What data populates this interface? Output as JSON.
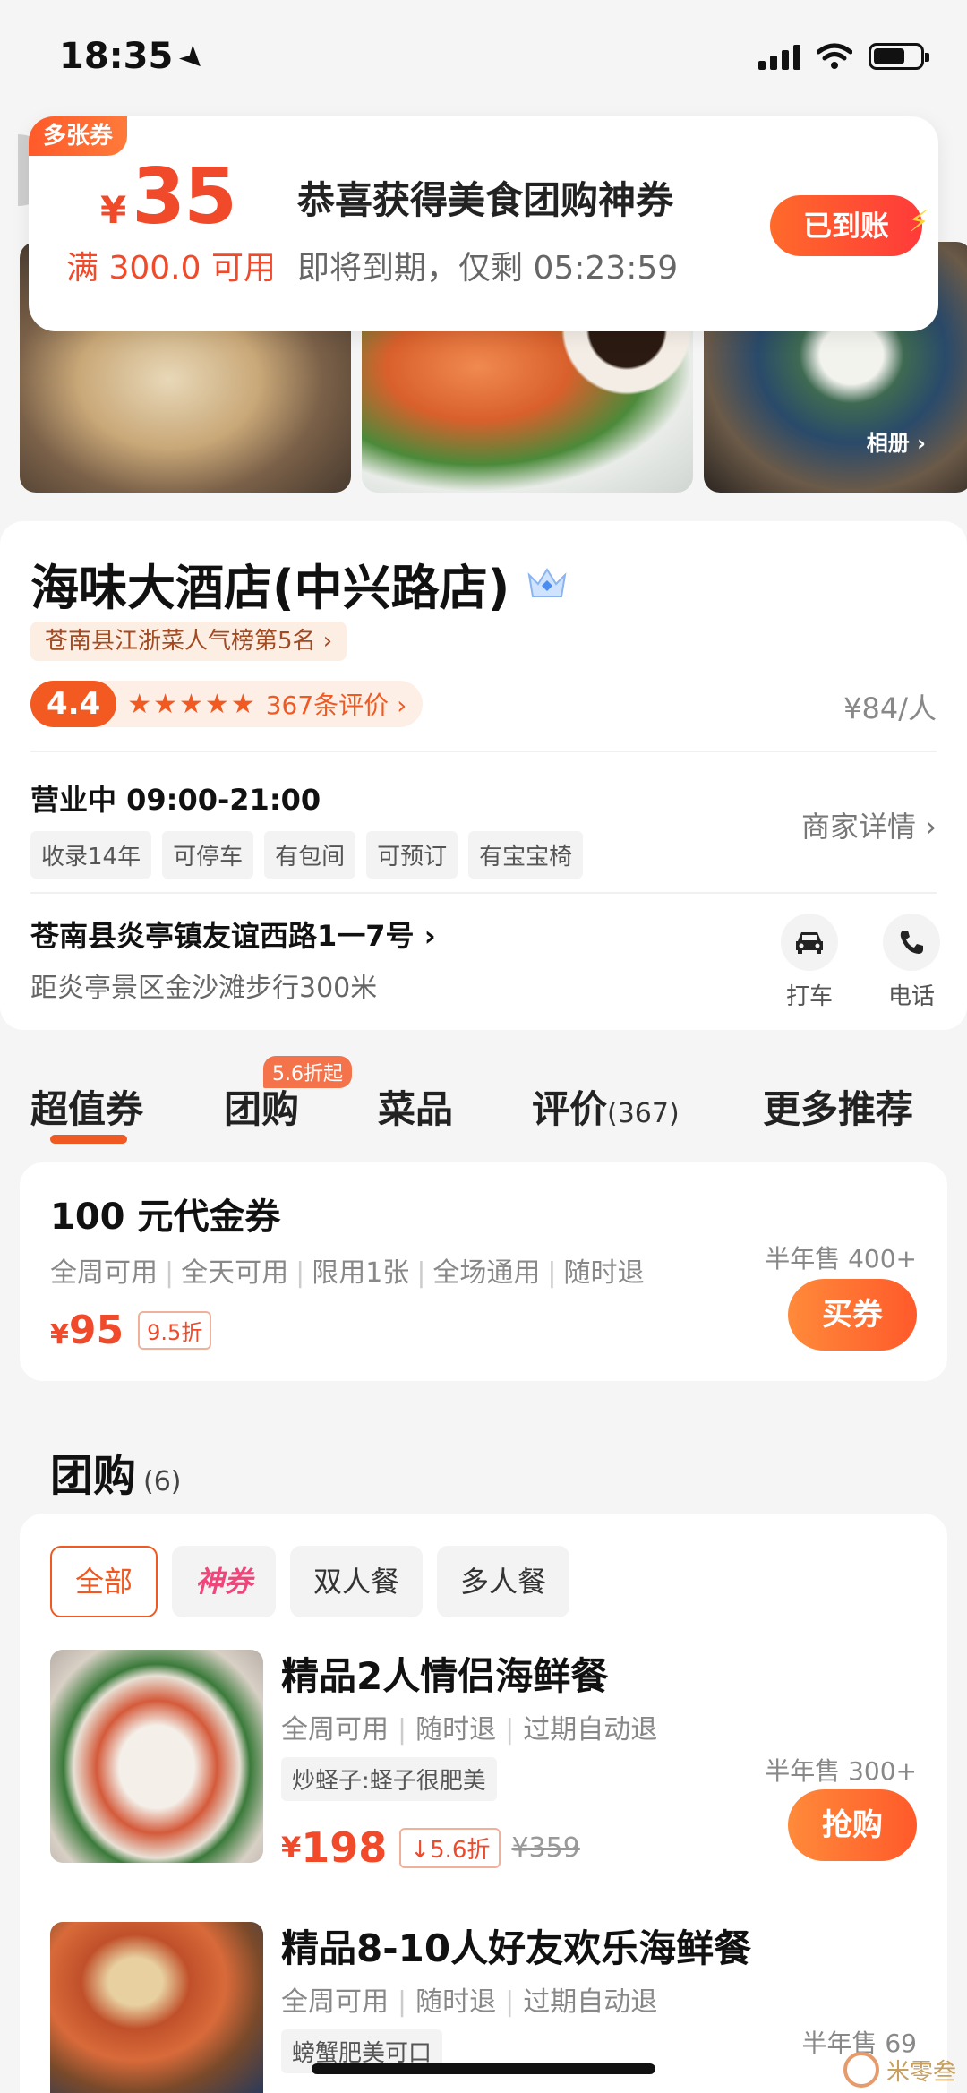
{
  "status_bar": {
    "time": "18:35"
  },
  "coupon_banner": {
    "badge": "多张券",
    "currency": "¥",
    "amount": "35",
    "condition": "满 300.0 可用",
    "title": "恭喜获得美食团购神券",
    "expiry": "即将到期，仅剩 05:23:59",
    "button": "已到账"
  },
  "photos": {
    "album_label": "相册 ›"
  },
  "shop": {
    "name": "海味大酒店(中兴路店)",
    "rank": "苍南县江浙菜人气榜第5名 ›",
    "score": "4.4",
    "stars": "★★★★★",
    "reviews": "367条评价 ›",
    "price_per": "¥84/人",
    "hours": "营业中 09:00-21:00",
    "tags": [
      "收录14年",
      "可停车",
      "有包间",
      "可预订",
      "有宝宝椅"
    ],
    "detail_link": "商家详情 ›",
    "address": "苍南县炎亭镇友谊西路1一7号 ›",
    "distance": "距炎亭景区金沙滩步行300米",
    "taxi_label": "打车",
    "phone_label": "电话"
  },
  "tabs": {
    "items": [
      "超值券",
      "团购",
      "菜品",
      "评价",
      "更多推荐"
    ],
    "review_count": "(367)",
    "badge": "5.6折起",
    "active": "超值券",
    "accent": "#f05a22"
  },
  "voucher": {
    "title": "100 元代金券",
    "rules": [
      "全周可用",
      "全天可用",
      "限用1张",
      "全场通用",
      "随时退"
    ],
    "currency": "¥",
    "price": "95",
    "discount": "9.5折",
    "sold": "半年售 400+",
    "button": "买券"
  },
  "group": {
    "title": "团购",
    "count": "(6)",
    "filters": [
      "全部",
      "神券",
      "双人餐",
      "多人餐"
    ],
    "deals": [
      {
        "title": "精品2人情侣海鲜餐",
        "rules": [
          "全周可用",
          "随时退",
          "过期自动退"
        ],
        "tag": "炒蛏子:蛏子很肥美",
        "currency": "¥",
        "price": "198",
        "discount": "↓5.6折",
        "original": "¥359",
        "sold": "半年售 300+",
        "button": "抢购"
      },
      {
        "title": "精品8-10人好友欢乐海鲜餐",
        "rules": [
          "全周可用",
          "随时退",
          "过期自动退"
        ],
        "tag": "螃蟹肥美可口",
        "sold": "半年售 69"
      }
    ]
  },
  "watermark": "米零叁"
}
